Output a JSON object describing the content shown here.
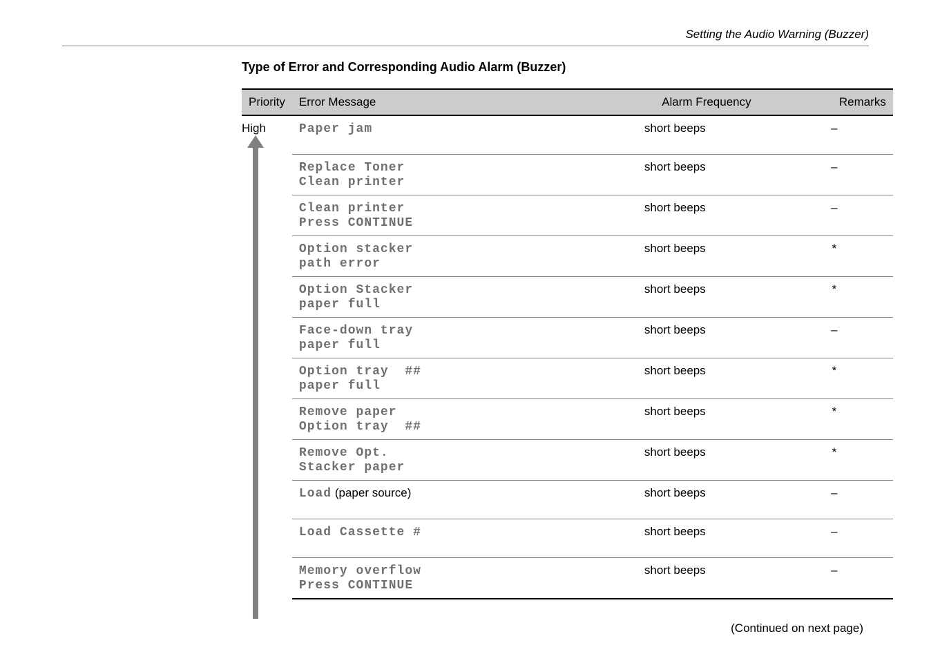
{
  "header": {
    "caption": "Setting the Audio Warning (Buzzer)"
  },
  "title": "Type of Error and Corresponding Audio Alarm (Buzzer)",
  "table": {
    "headers": {
      "priority": "Priority",
      "error": "Error Message",
      "freq": "Alarm Frequency",
      "remarks": "Remarks"
    },
    "priority_label": "High",
    "rows": [
      {
        "error_lcd": "Paper jam",
        "error_note": "",
        "freq": "short beeps",
        "remarks": "–"
      },
      {
        "error_lcd": "Replace Toner\nClean printer",
        "error_note": "",
        "freq": "short beeps",
        "remarks": "–"
      },
      {
        "error_lcd": "Clean printer\nPress CONTINUE",
        "error_note": "",
        "freq": "short beeps",
        "remarks": "–"
      },
      {
        "error_lcd": "Option stacker\npath error",
        "error_note": "",
        "freq": "short beeps",
        "remarks": "*"
      },
      {
        "error_lcd": "Option Stacker\npaper full",
        "error_note": "",
        "freq": "short beeps",
        "remarks": "*"
      },
      {
        "error_lcd": "Face-down tray\npaper full",
        "error_note": "",
        "freq": "short beeps",
        "remarks": "–"
      },
      {
        "error_lcd": "Option tray  ##\npaper full",
        "error_note": "",
        "freq": "short beeps",
        "remarks": "*"
      },
      {
        "error_lcd": "Remove paper\nOption tray  ##",
        "error_note": "",
        "freq": "short beeps",
        "remarks": "*"
      },
      {
        "error_lcd": "Remove Opt.\nStacker paper",
        "error_note": "",
        "freq": "short beeps",
        "remarks": "*"
      },
      {
        "error_lcd": "Load",
        "error_note": " (paper source)",
        "freq": "short beeps",
        "remarks": "–"
      },
      {
        "error_lcd": "Load Cassette #",
        "error_note": "",
        "freq": "short beeps",
        "remarks": "–"
      },
      {
        "error_lcd": "Memory overflow\nPress CONTINUE",
        "error_note": "",
        "freq": "short beeps",
        "remarks": "–"
      }
    ]
  },
  "footer": {
    "continued": "(Continued on next page)"
  }
}
